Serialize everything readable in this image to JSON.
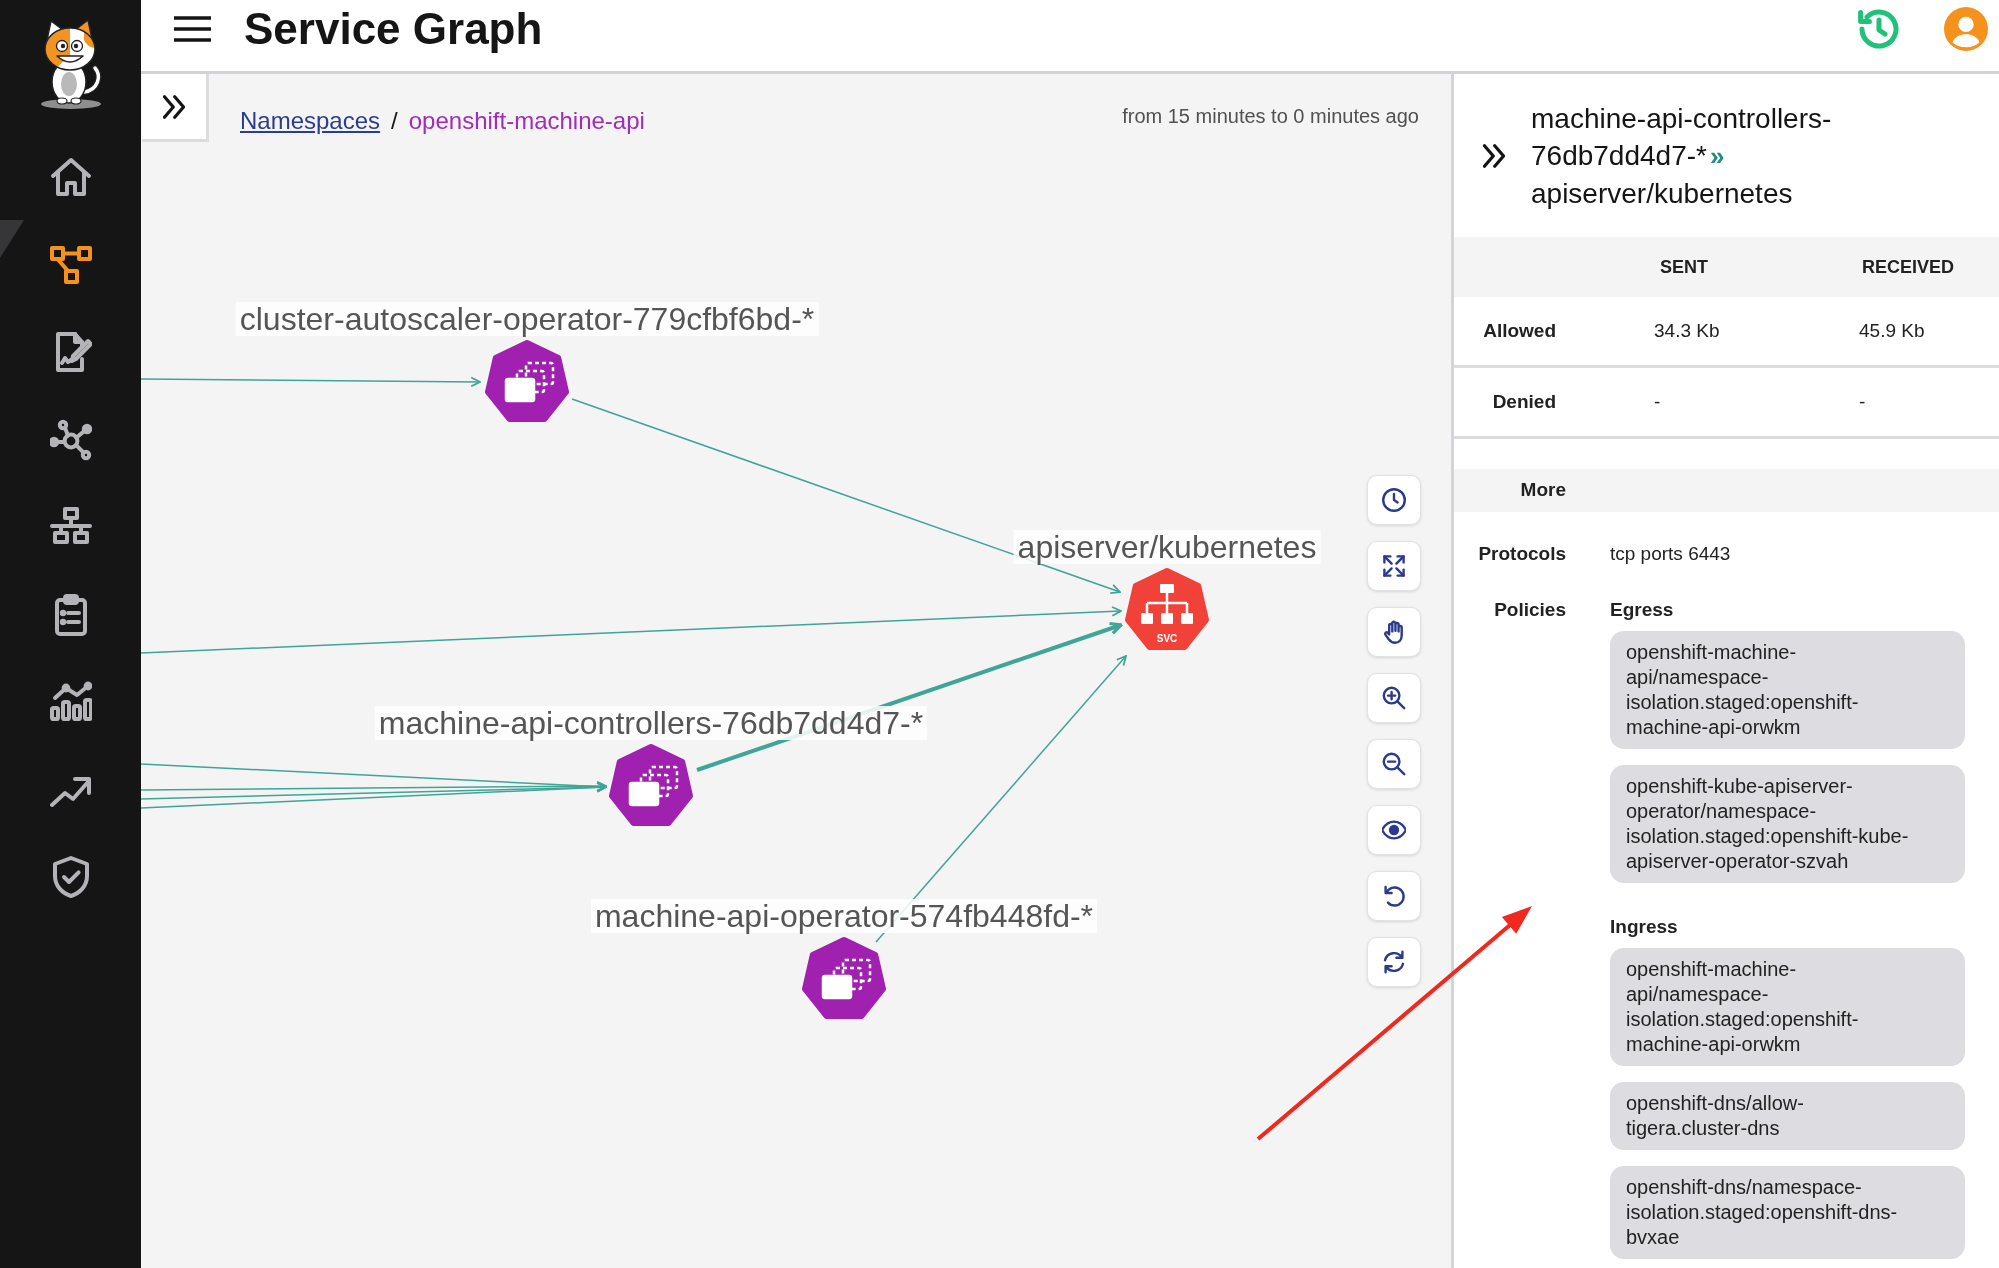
{
  "sidebar": {
    "items": [
      {
        "selected": false
      },
      {
        "selected": true
      },
      {
        "selected": false
      },
      {
        "selected": false
      },
      {
        "selected": false
      },
      {
        "selected": false
      },
      {
        "selected": false
      },
      {
        "selected": false
      },
      {
        "selected": false
      }
    ]
  },
  "header": {
    "title": "Service Graph"
  },
  "breadcrumb": {
    "items": [
      {
        "label": "Namespaces",
        "kind": "link"
      },
      {
        "label": "openshift-machine-api",
        "kind": "current"
      }
    ],
    "separator": "/"
  },
  "time_range": "from 15 minutes to 0 minutes ago",
  "graph": {
    "nodes": [
      {
        "label": "cluster-autoscaler-operator-779cfbf6bd-*",
        "kind": "workload"
      },
      {
        "label": "apiserver/kubernetes",
        "kind": "service",
        "badge": "SVC"
      },
      {
        "label": "machine-api-controllers-76db7dd4d7-*",
        "kind": "workload"
      },
      {
        "label": "machine-api-operator-574fb448fd-*",
        "kind": "workload"
      }
    ],
    "edges": [
      {
        "selected": false
      },
      {
        "selected": false
      },
      {
        "selected": false
      },
      {
        "selected": false
      },
      {
        "selected": false
      },
      {
        "selected": false
      },
      {
        "selected": false
      },
      {
        "selected": true
      },
      {
        "selected": false
      }
    ]
  },
  "details": {
    "title": {
      "source": "machine-api-controllers-76db7dd4d7-*",
      "separator": "»",
      "target": "apiserver/kubernetes"
    },
    "traffic": {
      "columns": [
        "SENT",
        "RECEIVED"
      ],
      "rows": [
        {
          "label": "Allowed",
          "values": [
            "34.3 Kb",
            "45.9 Kb"
          ]
        },
        {
          "label": "Denied",
          "values": [
            "-",
            "-"
          ]
        }
      ]
    },
    "more": {
      "heading": "More",
      "protocols": {
        "label": "Protocols",
        "value": "tcp ports 6443"
      },
      "policies": {
        "label": "Policies",
        "groups": [
          {
            "title": "Egress",
            "items": [
              "openshift-machine-api/namespace-isolation.staged:openshift-machine-api-orwkm",
              "openshift-kube-apiserver-operator/namespace-isolation.staged:openshift-kube-apiserver-operator-szvah"
            ]
          },
          {
            "title": "Ingress",
            "items": [
              "openshift-machine-api/namespace-isolation.staged:openshift-machine-api-orwkm",
              "openshift-dns/allow-tigera.cluster-dns",
              "openshift-dns/namespace-isolation.staged:openshift-dns-bvxae"
            ]
          }
        ]
      }
    }
  }
}
